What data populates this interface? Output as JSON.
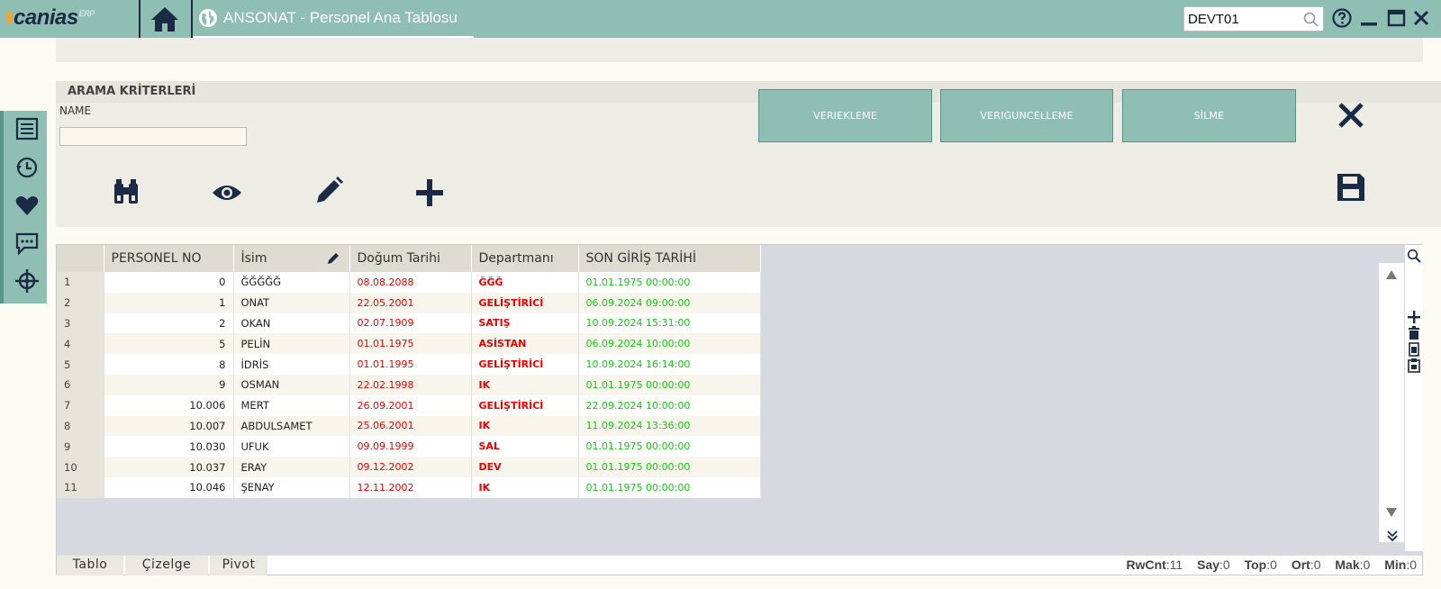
{
  "app": {
    "logo": "canias",
    "logo_sup": "ERP"
  },
  "tab": {
    "title": "ANSONAT - Personel Ana Tablosu"
  },
  "server": {
    "value": "DEVT01"
  },
  "search_panel": {
    "title": "ARAMA KRİTERLERİ",
    "name_label": "NAME",
    "name_value": ""
  },
  "actions": [
    "VERIEKLEME",
    "VERIGUNCELLEME",
    "SİLME"
  ],
  "columns": [
    "",
    "PERSONEL NO",
    "İsim",
    "Doğum Tarihi",
    "Departmanı",
    "SON GİRİŞ TARİHİ"
  ],
  "rows": [
    [
      "1",
      "0",
      "ĞĞĞĞĞ",
      "08.08.2088",
      "ĞĞĞ",
      "01.01.1975 00:00:00"
    ],
    [
      "2",
      "1",
      "ONAT",
      "22.05.2001",
      "GELİŞTİRİCİ",
      "06.09.2024 09:00:00"
    ],
    [
      "3",
      "2",
      "OKAN",
      "02.07.1909",
      "SATIŞ",
      "10.09.2024 15:31:00"
    ],
    [
      "4",
      "5",
      "PELİN",
      "01.01.1975",
      "ASİSTAN",
      "06.09.2024 10:00:00"
    ],
    [
      "5",
      "8",
      "İDRİS",
      "01.01.1995",
      "GELİŞTİRİCİ",
      "10.09.2024 16:14:00"
    ],
    [
      "6",
      "9",
      "OSMAN",
      "22.02.1998",
      "IK",
      "01.01.1975 00:00:00"
    ],
    [
      "7",
      "10.006",
      "MERT",
      "26.09.2001",
      "GELİŞTİRİCİ",
      "22.09.2024 10:00:00"
    ],
    [
      "8",
      "10.007",
      "ABDULSAMET",
      "25.06.2001",
      "IK",
      "11.09.2024 13:36:00"
    ],
    [
      "9",
      "10.030",
      "UFUK",
      "09.09.1999",
      "SAL",
      "01.01.1975 00:00:00"
    ],
    [
      "10",
      "10.037",
      "ERAY",
      "09.12.2002",
      "DEV",
      "01.01.1975 00:00:00"
    ],
    [
      "11",
      "10.046",
      "ŞENAY",
      "12.11.2002",
      "IK",
      "01.01.1975 00:00:00"
    ]
  ],
  "footer_tabs": [
    "Tablo",
    "Çizelge",
    "Pivot"
  ],
  "stats": {
    "rwcnt_label": "RwCnt",
    "rwcnt": ":11",
    "say_label": "Say",
    "say": ":0",
    "top_label": "Top",
    "top": ":0",
    "ort_label": "Ort",
    "ort": ":0",
    "mak_label": "Mak",
    "mak": ":0",
    "min_label": "Min",
    "min": ":0"
  },
  "colors": {
    "teal": "#8fbfb3",
    "navy": "#1b2b45",
    "red": "#e00000",
    "green": "#11cc11"
  }
}
